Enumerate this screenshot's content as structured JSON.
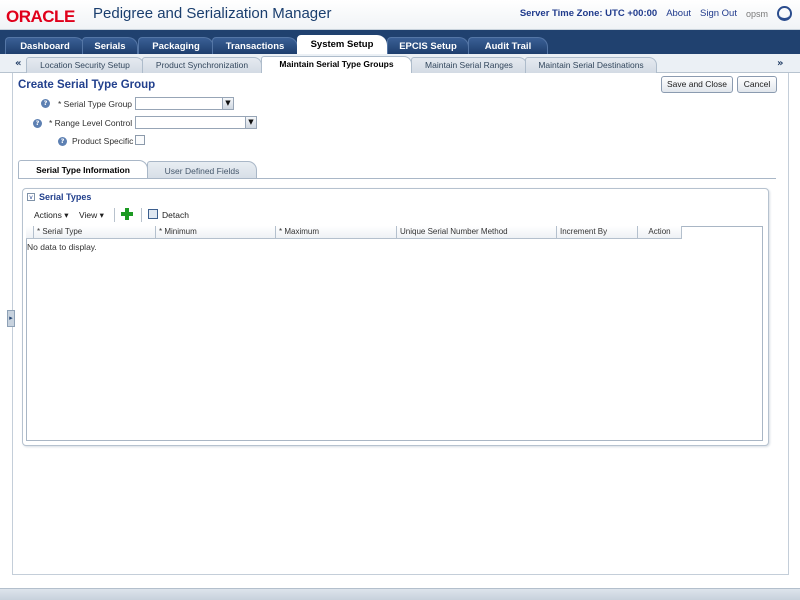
{
  "header": {
    "logo_text": "ORACLE",
    "app_title": "Pedigree and Serialization Manager",
    "server_time": "Server Time Zone: UTC +00:00",
    "about": "About",
    "sign_out": "Sign Out",
    "user": "opsm"
  },
  "main_tabs": [
    {
      "label": "Dashboard"
    },
    {
      "label": "Serials"
    },
    {
      "label": "Packaging"
    },
    {
      "label": "Transactions"
    },
    {
      "label": "System Setup"
    },
    {
      "label": "EPCIS Setup"
    },
    {
      "label": "Audit Trail"
    }
  ],
  "sub_tabs": [
    {
      "label": "Location Security Setup"
    },
    {
      "label": "Product Synchronization"
    },
    {
      "label": "Maintain Serial Type Groups"
    },
    {
      "label": "Maintain Serial Ranges"
    },
    {
      "label": "Maintain Serial Destinations"
    }
  ],
  "scroll": {
    "left": "«",
    "right": "»"
  },
  "page": {
    "title": "Create Serial Type Group",
    "save_close": "Save and Close",
    "cancel": "Cancel"
  },
  "form": {
    "serial_type_group": {
      "label": "* Serial Type Group",
      "value": ""
    },
    "range_level_control": {
      "label": "* Range Level Control",
      "value": ""
    },
    "product_specific": {
      "label": "Product Specific",
      "checked": false
    },
    "help_glyph": "?"
  },
  "detail_tabs": [
    {
      "label": "Serial Type Information"
    },
    {
      "label": "User Defined Fields"
    }
  ],
  "serial_types": {
    "title": "Serial Types",
    "collapse_glyph": "v",
    "actions": "Actions ▾",
    "view": "View ▾",
    "detach": "Detach",
    "columns": [
      "* Serial Type",
      "* Minimum",
      "* Maximum",
      "Unique Serial Number Method",
      "Increment By",
      "Action"
    ],
    "empty_text": "No data to display."
  },
  "side_handle_glyph": "▸"
}
